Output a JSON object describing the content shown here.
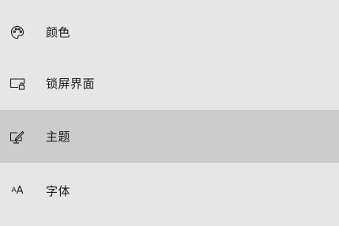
{
  "nav": {
    "items": [
      {
        "label": "颜色",
        "icon": "palette-icon",
        "selected": false
      },
      {
        "label": "锁屏界面",
        "icon": "lock-screen-icon",
        "selected": false
      },
      {
        "label": "主题",
        "icon": "theme-icon",
        "selected": true
      },
      {
        "label": "字体",
        "icon": "font-icon",
        "selected": false
      }
    ],
    "font_icon_glyphs": {
      "small": "A",
      "large": "A"
    }
  },
  "colors": {
    "background": "#e6e6e6",
    "selected_background": "#cccccc",
    "text": "#1a1a1a"
  }
}
